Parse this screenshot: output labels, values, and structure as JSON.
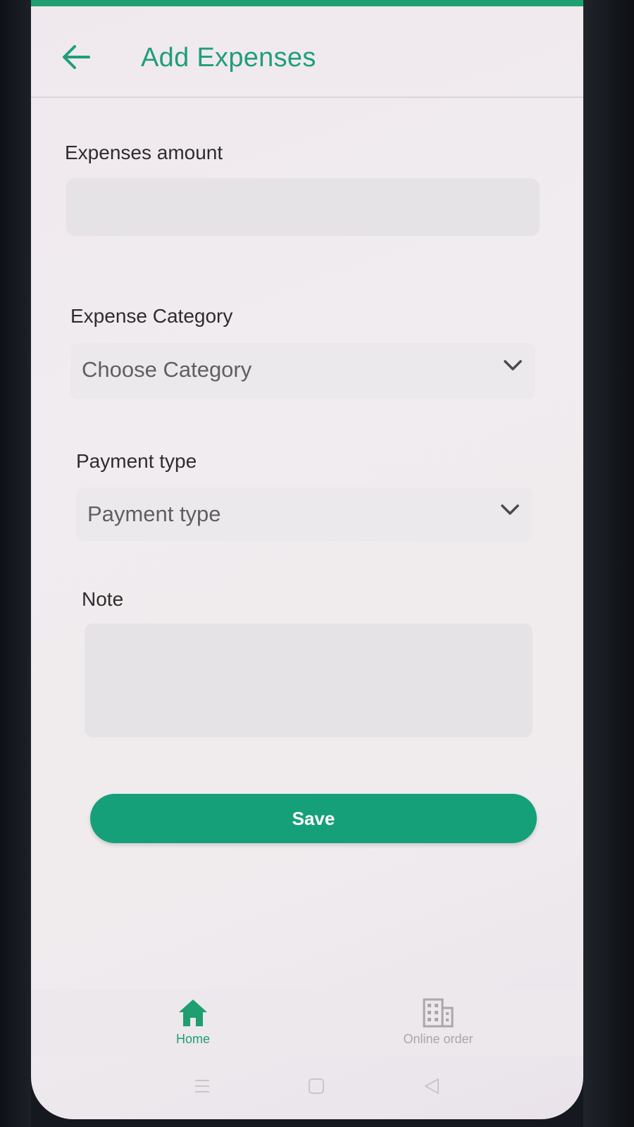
{
  "header": {
    "title": "Add Expenses",
    "back_icon": "arrow-left-icon"
  },
  "form": {
    "amount_label": "Expenses amount",
    "amount_value": "",
    "category_label": "Expense Category",
    "category_placeholder": "Choose Category",
    "payment_label": "Payment type",
    "payment_placeholder": "Payment type",
    "note_label": "Note",
    "note_value": "",
    "save_label": "Save"
  },
  "bottom_nav": {
    "items": [
      {
        "label": "Home",
        "icon": "home-icon",
        "active": true
      },
      {
        "label": "Online order",
        "icon": "building-icon",
        "active": false
      }
    ]
  },
  "system_nav": {
    "icons": [
      "menu-icon",
      "home-square-icon",
      "back-triangle-icon"
    ]
  },
  "colors": {
    "accent": "#1f9e7a",
    "button": "#16a079"
  }
}
